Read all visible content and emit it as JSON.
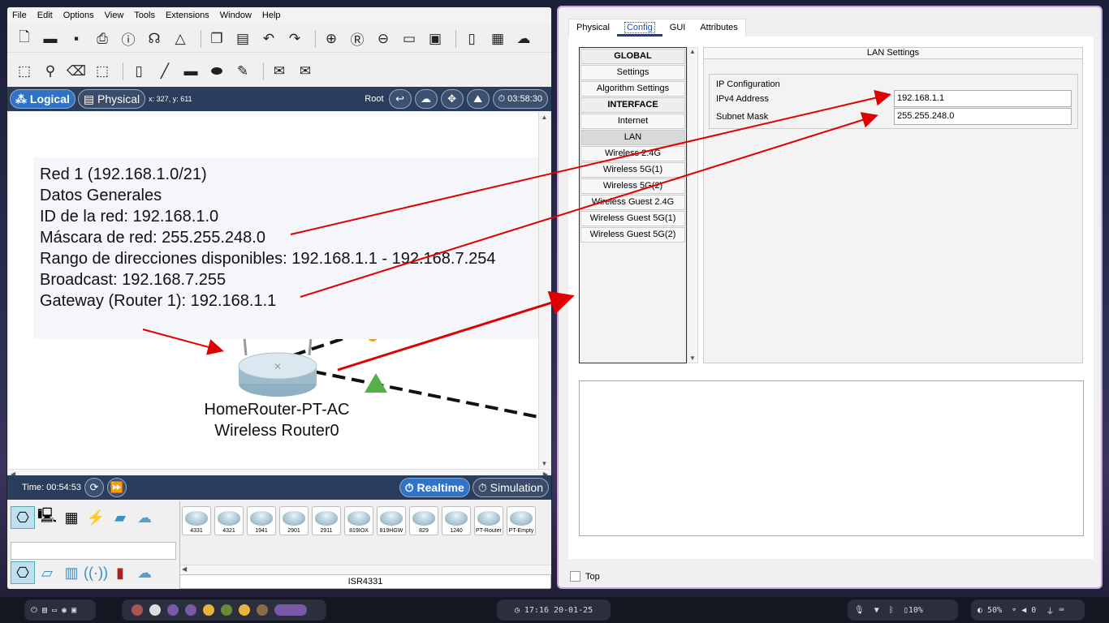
{
  "menu": [
    "File",
    "Edit",
    "Options",
    "View",
    "Tools",
    "Extensions",
    "Window",
    "Help"
  ],
  "modebar": {
    "logical": "Logical",
    "physical": "Physical",
    "coords": "x: 327, y: 611",
    "root": "Root",
    "clock": "03:58:30"
  },
  "note": {
    "lines": [
      "Red 1 (192.168.1.0/21)",
      "Datos Generales",
      "ID de la red: 192.168.1.0",
      "Máscara de red: 255.255.248.0",
      "Rango de direcciones disponibles: 192.168.1.1 - 192.168.7.254",
      "Broadcast: 192.168.7.255",
      "Gateway (Router 1): 192.168.1.1"
    ]
  },
  "router": {
    "model": "HomeRouter-PT-AC",
    "name": "Wireless Router0"
  },
  "timebar": {
    "time": "Time: 00:54:53",
    "realtime": "Realtime",
    "simulation": "Simulation"
  },
  "devices": {
    "tiles": [
      "4331",
      "4321",
      "1941",
      "2901",
      "2911",
      "819IOX",
      "819HGW",
      "829",
      "1240",
      "PT-Router",
      "PT-Empty"
    ],
    "selected_model": "ISR4331"
  },
  "config": {
    "tabs": [
      "Physical",
      "Config",
      "GUI",
      "Attributes"
    ],
    "active_tab": "Config",
    "list": [
      {
        "label": "GLOBAL",
        "kind": "header"
      },
      {
        "label": "Settings",
        "kind": "item"
      },
      {
        "label": "Algorithm Settings",
        "kind": "item"
      },
      {
        "label": "INTERFACE",
        "kind": "header"
      },
      {
        "label": "Internet",
        "kind": "item"
      },
      {
        "label": "LAN",
        "kind": "selected"
      },
      {
        "label": "Wireless 2.4G",
        "kind": "item"
      },
      {
        "label": "Wireless 5G(1)",
        "kind": "item"
      },
      {
        "label": "Wireless 5G(2)",
        "kind": "item"
      },
      {
        "label": "Wireless Guest 2.4G",
        "kind": "item"
      },
      {
        "label": "Wireless Guest 5G(1)",
        "kind": "item"
      },
      {
        "label": "Wireless Guest 5G(2)",
        "kind": "item"
      }
    ],
    "lan_title": "LAN Settings",
    "ip_group": "IP Configuration",
    "ipv4_label": "IPv4 Address",
    "ipv4_value": "192.168.1.1",
    "mask_label": "Subnet Mask",
    "mask_value": "255.255.248.0",
    "top_label": "Top"
  },
  "taskbar": {
    "datetime": "17:16   20-01-25",
    "battery": "10%",
    "brightness": "50%",
    "volume": "0"
  },
  "colors": {
    "accent_blue": "#2f73c9",
    "annotation_red": "#e00000",
    "link_green": "#55b04a"
  }
}
